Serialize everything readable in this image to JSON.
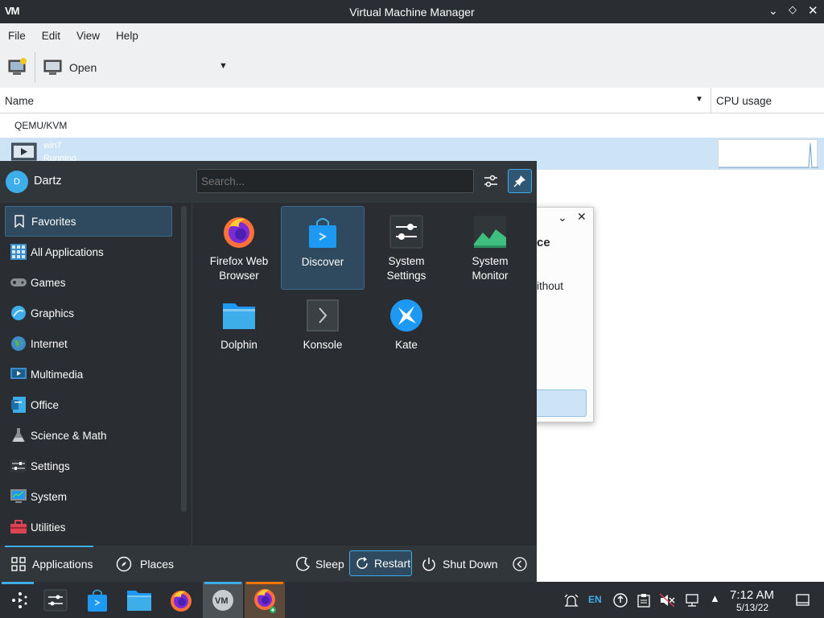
{
  "vmm": {
    "title": "Virtual Machine Manager",
    "menu": [
      "File",
      "Edit",
      "View",
      "Help"
    ],
    "toolbar_open": "Open",
    "columns": {
      "name": "Name",
      "cpu": "CPU usage"
    },
    "connection": "QEMU/KVM",
    "vm": {
      "name": "win7",
      "status": "Running"
    }
  },
  "dialog": {
    "text1": "ce",
    "text2": "ithout"
  },
  "kickoff": {
    "user": "Dartz",
    "user_initial": "D",
    "search_placeholder": "Search...",
    "categories": [
      {
        "label": "Favorites",
        "icon": "bookmark-icon"
      },
      {
        "label": "All Applications",
        "icon": "grid-icon"
      },
      {
        "label": "Games",
        "icon": "gamepad-icon"
      },
      {
        "label": "Graphics",
        "icon": "graphics-icon"
      },
      {
        "label": "Internet",
        "icon": "globe-icon"
      },
      {
        "label": "Multimedia",
        "icon": "multimedia-icon"
      },
      {
        "label": "Office",
        "icon": "office-icon"
      },
      {
        "label": "Science & Math",
        "icon": "flask-icon"
      },
      {
        "label": "Settings",
        "icon": "sliders-icon"
      },
      {
        "label": "System",
        "icon": "system-icon"
      },
      {
        "label": "Utilities",
        "icon": "toolbox-icon"
      }
    ],
    "apps": [
      {
        "label": "Firefox Web Browser",
        "l1": "Firefox Web",
        "l2": "Browser",
        "icon": "firefox-icon"
      },
      {
        "label": "Discover",
        "l1": "Discover",
        "l2": "",
        "icon": "discover-icon"
      },
      {
        "label": "System Settings",
        "l1": "System",
        "l2": "Settings",
        "icon": "system-settings-icon"
      },
      {
        "label": "System Monitor",
        "l1": "System",
        "l2": "Monitor",
        "icon": "system-monitor-icon"
      },
      {
        "label": "Dolphin",
        "l1": "Dolphin",
        "l2": "",
        "icon": "dolphin-icon"
      },
      {
        "label": "Konsole",
        "l1": "Konsole",
        "l2": "",
        "icon": "konsole-icon"
      },
      {
        "label": "Kate",
        "l1": "Kate",
        "l2": "",
        "icon": "kate-icon"
      }
    ],
    "footer": {
      "applications": "Applications",
      "places": "Places",
      "sleep": "Sleep",
      "restart": "Restart",
      "shutdown": "Shut Down"
    }
  },
  "taskbar": {
    "lang": "EN",
    "time": "7:12 AM",
    "date": "5/13/22"
  },
  "colors": {
    "accent": "#3daee9",
    "panel": "#2a2e32",
    "selection": "#cde4f7"
  }
}
